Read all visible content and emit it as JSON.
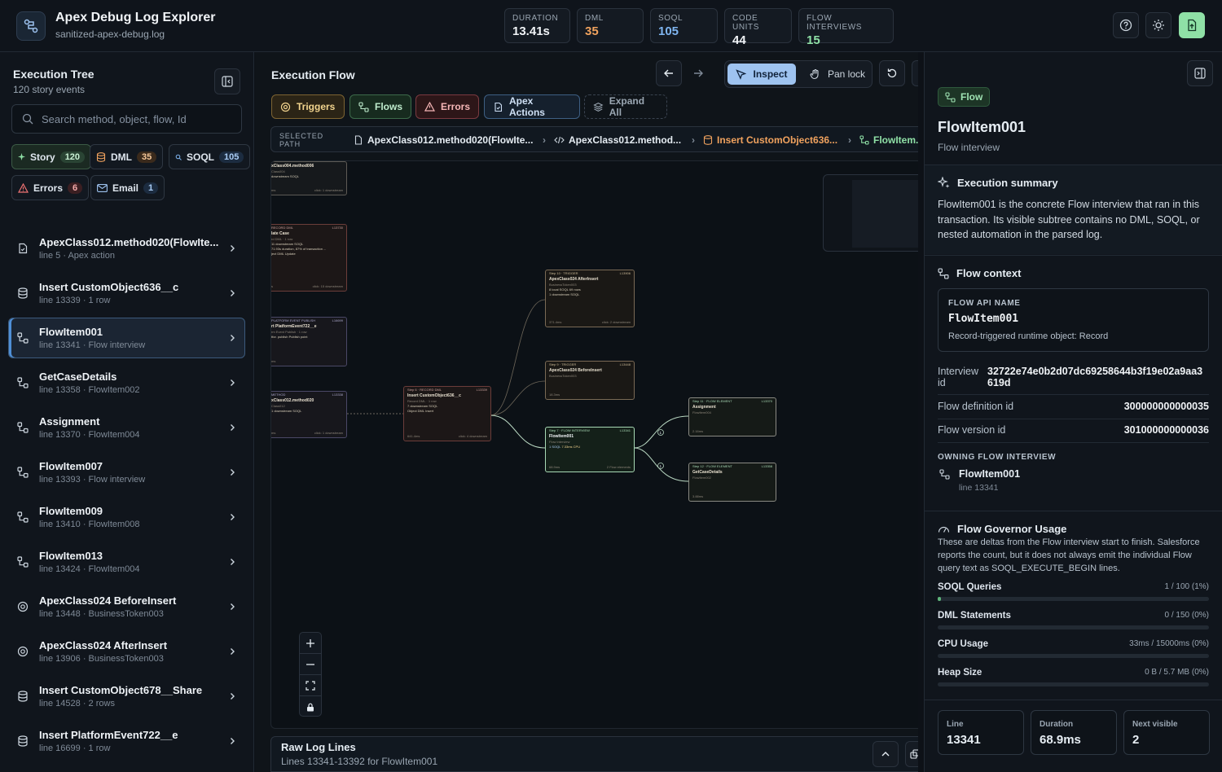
{
  "app": {
    "title": "Apex Debug Log Explorer",
    "file": "sanitized-apex-debug.log"
  },
  "metrics": [
    {
      "label": "DURATION",
      "value": "13.41s",
      "color": "#f0f3f6"
    },
    {
      "label": "DML",
      "value": "35",
      "color": "#f0a25e"
    },
    {
      "label": "SOQL",
      "value": "105",
      "color": "#7fb5f0"
    },
    {
      "label": "CODE UNITS",
      "value": "44",
      "color": "#f0f3f6"
    },
    {
      "label": "FLOW INTERVIEWS",
      "value": "15",
      "color": "#8fe0a6"
    }
  ],
  "tree": {
    "title": "Execution Tree",
    "subtitle": "120 story events",
    "search_placeholder": "Search method, object, flow, Id",
    "chips": [
      {
        "label": "Story",
        "count": "120"
      },
      {
        "label": "DML",
        "count": "35"
      },
      {
        "label": "SOQL",
        "count": "105"
      },
      {
        "label": "Errors",
        "count": "6"
      },
      {
        "label": "Email",
        "count": "1"
      }
    ],
    "items": [
      {
        "title": "ApexClass012.method020(FlowIte...",
        "meta": "line 5 · Apex action",
        "icon": "apex-action-icon"
      },
      {
        "title": "Insert CustomObject636__c",
        "meta": "line 13339 · 1 row",
        "icon": "database-icon"
      },
      {
        "title": "FlowItem001",
        "meta": "line 13341 · Flow interview",
        "icon": "flow-icon"
      },
      {
        "title": "GetCaseDetails",
        "meta": "line 13358 · FlowItem002",
        "icon": "flow-icon"
      },
      {
        "title": "Assignment",
        "meta": "line 13370 · FlowItem004",
        "icon": "flow-icon"
      },
      {
        "title": "FlowItem007",
        "meta": "line 13393 · Flow interview",
        "icon": "flow-icon"
      },
      {
        "title": "FlowItem009",
        "meta": "line 13410 · FlowItem008",
        "icon": "flow-icon"
      },
      {
        "title": "FlowItem013",
        "meta": "line 13424 · FlowItem004",
        "icon": "flow-icon"
      },
      {
        "title": "ApexClass024 BeforeInsert",
        "meta": "line 13448 · BusinessToken003",
        "icon": "trigger-icon"
      },
      {
        "title": "ApexClass024 AfterInsert",
        "meta": "line 13906 · BusinessToken003",
        "icon": "trigger-icon"
      },
      {
        "title": "Insert CustomObject678__Share",
        "meta": "line 14528 · 2 rows",
        "icon": "database-icon"
      },
      {
        "title": "Insert PlatformEvent722__e",
        "meta": "line 16699 · 1 row",
        "icon": "database-icon"
      }
    ]
  },
  "flow": {
    "title": "Execution Flow",
    "inspect_label": "Inspect",
    "pan_label": "Pan lock",
    "filters": {
      "triggers": "Triggers",
      "flows": "Flows",
      "errors": "Errors",
      "apex_actions": "Apex Actions",
      "expand_all": "Expand All"
    },
    "path_label_1": "SELECTED",
    "path_label_2": "PATH",
    "crumbs": [
      "ApexClass012.method020(FlowIte...",
      "ApexClass012.method...",
      "Insert CustomObject636...",
      "FlowItem..."
    ],
    "raw_title": "Raw Log Lines",
    "raw_sub": "Lines 13341-13392 for FlowItem001"
  },
  "nodes": {
    "n_top": {
      "title": "xClass004.method006",
      "sub": "Class004",
      "chip": "downstream SOQL",
      "foot_l": "ms",
      "foot_r": "click: 1 downstream"
    },
    "n_case": {
      "tag": "RECORD DML",
      "line": "L13730",
      "title": "late Case",
      "sub": "rd DML · 1 row",
      "chip": "11 downstream SOQL",
      "chip2": "71.93s duration, 87% of transaction ...",
      "chip3": "ject DML",
      "chip4": "Update",
      "foot_l": "s",
      "foot_r": "click: 15 downstream"
    },
    "n_plat": {
      "tag": "PLATFORM EVENT PUBLISH",
      "line": "L16699",
      "title": "rt PlatformEvent722__e",
      "sub": "rm Event Publish · 1 row",
      "chip": "tfor. publish",
      "chip2": "Publish point",
      "foot_l": "ms",
      "foot_r": ""
    },
    "n_method": {
      "tag": "METHOD",
      "line": "L13338",
      "title": "xClass012.method020",
      "sub": "Class012",
      "chip": "1 downstream SOQL",
      "foot_l": "ms",
      "foot_r": "click: 1 downstream"
    },
    "n_insert": {
      "tag": "RECORD DML",
      "line": "L13339",
      "step": "Step 6",
      "title": "Insert CustomObject636__c",
      "sub": "Record DML · 1 row",
      "chip": "7 downstream SOQL",
      "chip2": "Object DML",
      "chip3": "Insert",
      "foot_l": "641.4ms",
      "foot_r": "click: 4 downstream"
    },
    "n_after": {
      "tag": "TRIGGER",
      "line": "L13906",
      "step": "Step 10",
      "title": "ApexClass024 AfterInsert",
      "sub": "BusinessToken003",
      "chip": "8 local SOQL",
      "chip2": "69 rows",
      "chip3": "1 downstream SOQL",
      "foot_l": "371.4ms",
      "foot_r": "click: 2 downstream"
    },
    "n_before": {
      "tag": "TRIGGER",
      "line": "L13448",
      "step": "Step 9",
      "title": "ApexClass024 BeforeInsert",
      "sub": "BusinessToken003",
      "foot_l": "18.3ms"
    },
    "n_flow": {
      "tag": "FLOW INTERVIEW",
      "line": "L13341",
      "step": "Step 7",
      "title": "FlowItem001",
      "sub": "Flow interview",
      "chip": "1 SOQL",
      "chip2": "7.33ms CPU",
      "foot_l": "68.9ms",
      "foot_r": "2 Flow elements"
    },
    "n_assign": {
      "tag": "FLOW ELEMENT",
      "line": "L13370",
      "step": "Step 11",
      "title": "Assignment",
      "sub": "FlowItem004",
      "foot_l": "2.16ms"
    },
    "n_getcase": {
      "tag": "FLOW ELEMENT",
      "line": "L13358",
      "step": "Step 12",
      "title": "GetCaseDetails",
      "sub": "FlowItem002",
      "foot_l": "3.88ms"
    },
    "edge_label_1": "1",
    "edge_label_2": "1"
  },
  "detail": {
    "badge": "Flow",
    "title": "FlowItem001",
    "subtitle": "Flow interview",
    "summary_title": "Execution summary",
    "summary_text": "FlowItem001 is the concrete Flow interview that ran in this transaction. Its visible subtree contains no DML, SOQL, or nested automation in the parsed log.",
    "context_title": "Flow context",
    "api_label": "FLOW API NAME",
    "api_value": "FlowItem001",
    "api_desc": "Record-triggered runtime object: Record",
    "interview_label_1": "Interview",
    "interview_label_2": "id",
    "interview_value_1": "32722e74e0b2d07dc69258644b3f19e02a9aa3",
    "interview_value_2": "619d",
    "def_label": "Flow definition id",
    "def_value": "300000000000035",
    "ver_label": "Flow version id",
    "ver_value": "301000000000036",
    "owning_label": "OWNING FLOW INTERVIEW",
    "owning_name": "FlowItem001",
    "owning_line": "line 13341",
    "gov_title": "Flow Governor Usage",
    "gov_text": "These are deltas from the Flow interview start to finish. Salesforce reports the count, but it does not always emit the individual Flow query text as SOQL_EXECUTE_BEGIN lines.",
    "governor": [
      {
        "name": "SOQL Queries",
        "value": "1 / 100 (1%)",
        "pct": 1
      },
      {
        "name": "DML Statements",
        "value": "0 / 150 (0%)",
        "pct": 0
      },
      {
        "name": "CPU Usage",
        "value": "33ms / 15000ms (0%)",
        "pct": 0
      },
      {
        "name": "Heap Size",
        "value": "0 B / 5.7 MB (0%)",
        "pct": 0
      }
    ],
    "stats": [
      {
        "label": "Line",
        "value": "13341"
      },
      {
        "label": "Duration",
        "value": "68.9ms"
      },
      {
        "label": "Next visible",
        "value": "2"
      }
    ]
  },
  "colors": {
    "accent": "#4f8fd6",
    "flow": "#8fe0a6",
    "dml": "#f0a25e",
    "error": "#f07373"
  }
}
